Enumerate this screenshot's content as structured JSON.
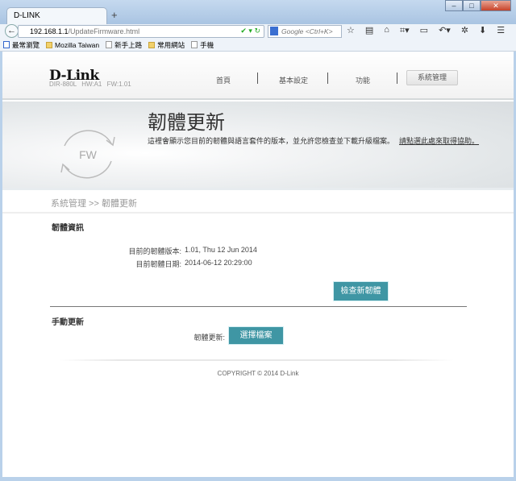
{
  "browser": {
    "tab_title": "D-LINK",
    "new_tab": "+",
    "url_host": "192.168.1.1",
    "url_path": "/UpdateFirmware.html",
    "search_placeholder": "Google <Ctrl+K>",
    "bookmarks": [
      "最常瀏覽",
      "Mozilla Taiwan",
      "新手上路",
      "常用網站",
      "手機"
    ]
  },
  "header": {
    "logo": "D-Link",
    "model": "DIR-880L",
    "hw": "HW:A1",
    "fw": "FW:1.01",
    "nav": [
      "首頁",
      "基本設定",
      "功能",
      "系統管理"
    ],
    "active_nav": "系統管理"
  },
  "banner": {
    "icon_text": "FW",
    "title": "韌體更新",
    "description": "這裡會顯示您目前的韌體與語言套件的版本，並允許您檢查並下載升級檔案。",
    "help_link": "請點選此處來取得協助。"
  },
  "breadcrumb": "系統管理 >> 韌體更新",
  "firmware_info": {
    "title": "韌體資訊",
    "version_label": "目前的韌體版本:",
    "version_value": "1.01, Thu 12 Jun 2014",
    "date_label": "目前韌體日期:",
    "date_value": "2014-06-12 20:29:00",
    "check_button": "檢查新韌體"
  },
  "manual_update": {
    "title": "手動更新",
    "label": "韌體更新:",
    "choose_button": "選擇檔案"
  },
  "footer": "COPYRIGHT © 2014 D-Link",
  "colors": {
    "accent": "#3f96a4"
  }
}
